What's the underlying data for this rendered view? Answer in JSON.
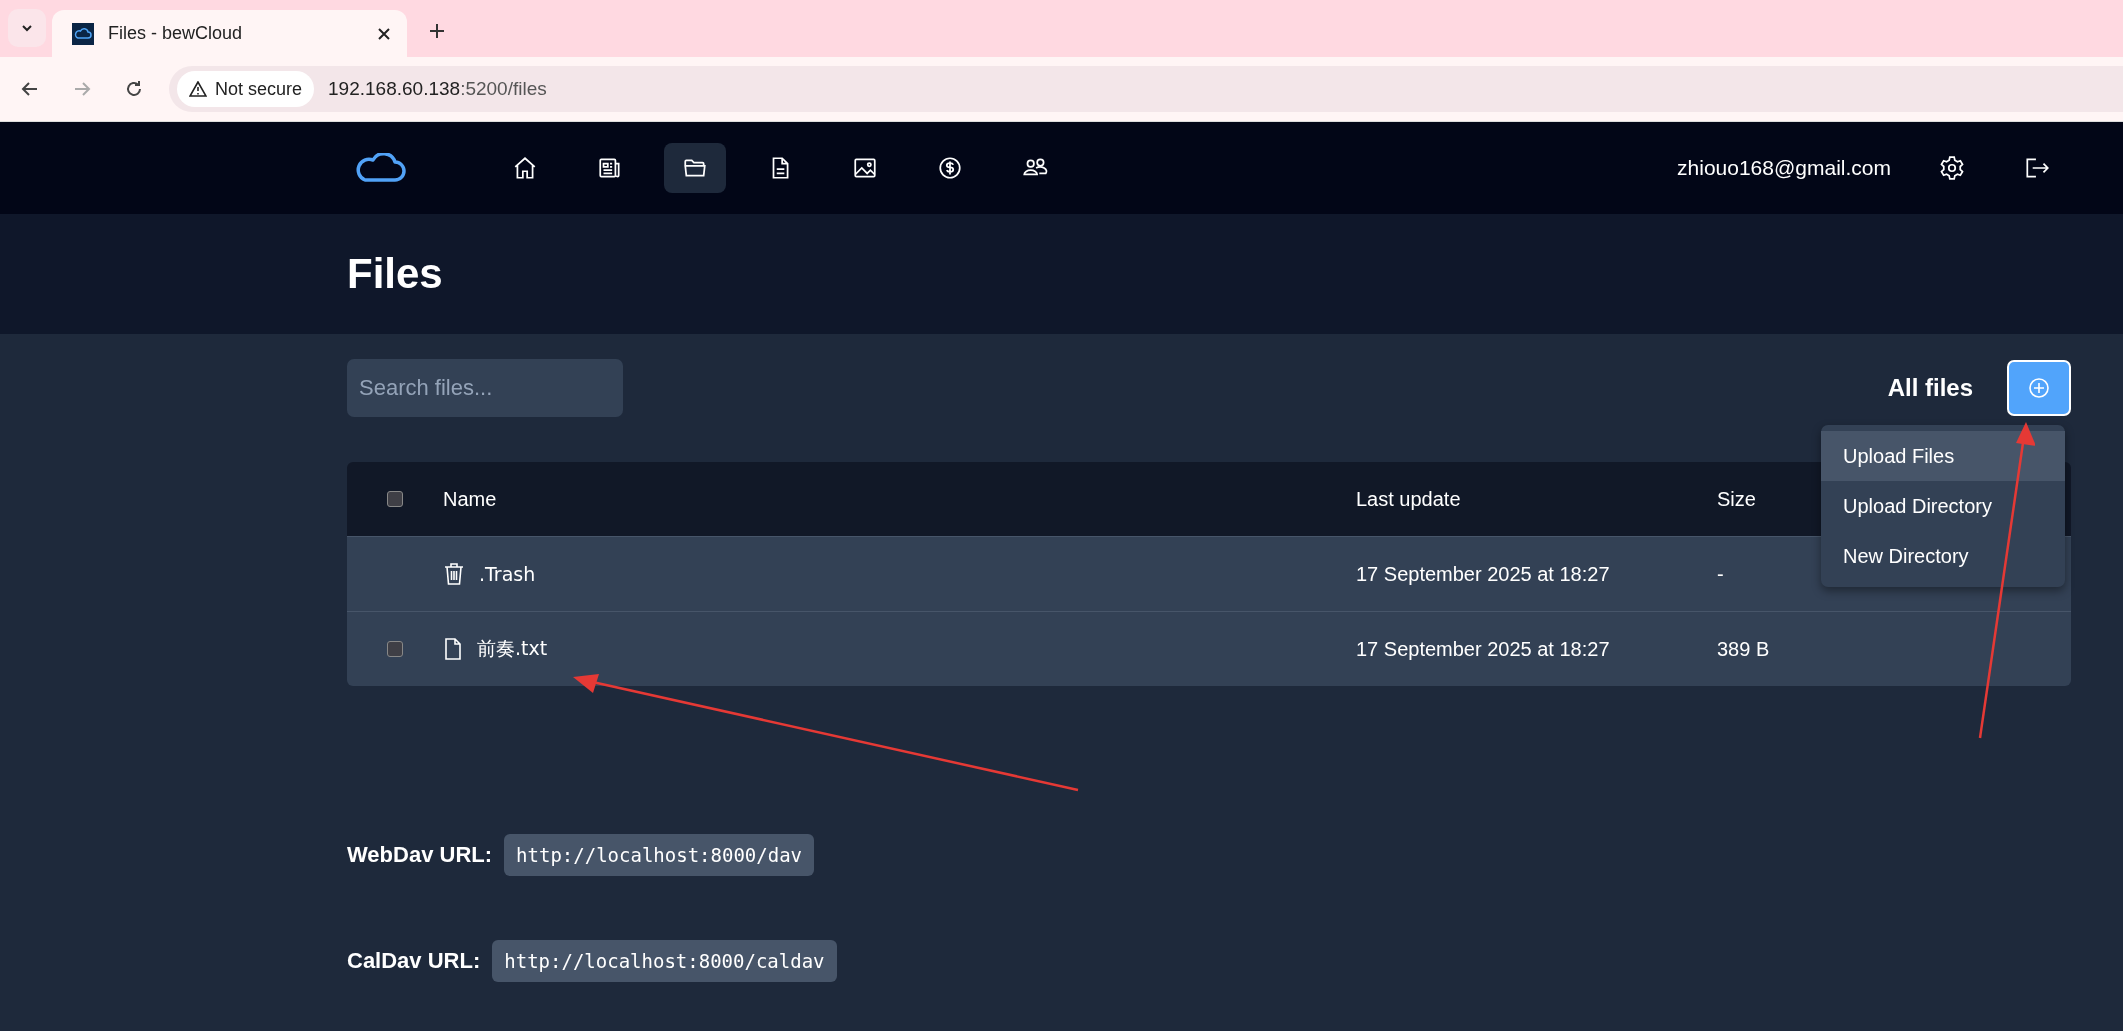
{
  "browser": {
    "tab_title": "Files - bewCloud",
    "address_warning": "Not secure",
    "address_host": "192.168.60.138",
    "address_rest": ":5200/files"
  },
  "nav": {
    "items": [
      {
        "kind": "home",
        "selected": false
      },
      {
        "kind": "news",
        "selected": false
      },
      {
        "kind": "files",
        "selected": true
      },
      {
        "kind": "notes",
        "selected": false
      },
      {
        "kind": "photos",
        "selected": false
      },
      {
        "kind": "expenses",
        "selected": false
      },
      {
        "kind": "contacts",
        "selected": false
      }
    ],
    "user_email": "zhiouo168@gmail.com"
  },
  "page_title": "Files",
  "search": {
    "placeholder": "Search files..."
  },
  "path_label": "All files",
  "add_menu": {
    "open": true,
    "items": [
      {
        "label": "Upload Files",
        "selected": true
      },
      {
        "label": "Upload Directory",
        "selected": false
      },
      {
        "label": "New Directory",
        "selected": false
      }
    ]
  },
  "table": {
    "header_checked": false,
    "columns": [
      "Name",
      "Last update",
      "Size"
    ],
    "rows": [
      {
        "kind": "trash",
        "name": ".Trash",
        "last_update": "17 September 2025 at 18:27",
        "size": "-"
      },
      {
        "kind": "file",
        "checked": false,
        "name": "前奏.txt",
        "last_update": "17 September 2025 at 18:27",
        "size": "389 B"
      }
    ]
  },
  "urls": [
    {
      "label": "WebDav URL:",
      "value": "http://localhost:8000/dav"
    },
    {
      "label": "CalDav URL:",
      "value": "http://localhost:8000/caldav"
    }
  ]
}
